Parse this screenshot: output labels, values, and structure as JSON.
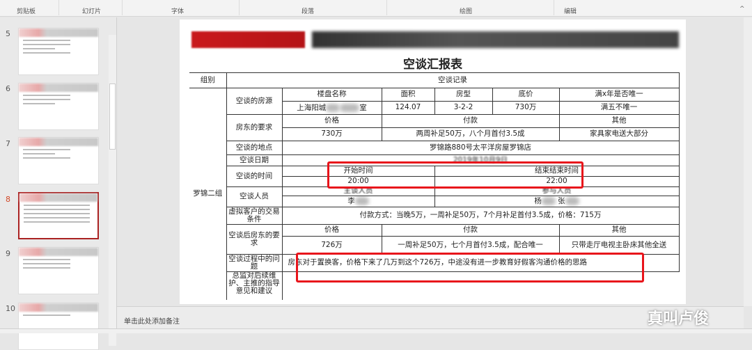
{
  "ribbon": {
    "groups": [
      "剪贴板",
      "幻灯片",
      "字体",
      "段落",
      "绘图",
      "编辑"
    ]
  },
  "thumbnails": [
    {
      "num": "5"
    },
    {
      "num": "6"
    },
    {
      "num": "7"
    },
    {
      "num": "8",
      "selected": true
    },
    {
      "num": "9"
    },
    {
      "num": "10"
    }
  ],
  "slide": {
    "title": "空谈汇报表",
    "table": {
      "group_header": "组别",
      "record_header": "空谈记录",
      "group": "罗锦二组",
      "listing_label": "空谈的房源",
      "listing_cols": [
        "楼盘名称",
        "面积",
        "房型",
        "底价",
        "满x年是否唯一"
      ],
      "listing_name_start": "上海阳城",
      "listing_name_end": "室",
      "listing_vals": [
        "124.07",
        "3-2-2",
        "730万",
        "满五不唯一"
      ],
      "owner_label": "房东的要求",
      "owner_cols": [
        "价格",
        "付款",
        "其他"
      ],
      "owner_vals": [
        "730万",
        "两周补足50万，八个月首付3.5成",
        "家具家电送大部分"
      ],
      "place_label": "空谈的地点",
      "place": "罗锦路880号太平洋房屋罗锦店",
      "date_label": "空谈日期",
      "date": "2019年10月9日",
      "time_label": "空谈的时间",
      "time_cols": [
        "开始时间",
        "结束结束时间"
      ],
      "time_vals": [
        "20:00",
        "22:00"
      ],
      "people_label": "空谈人员",
      "people_cols": [
        "主谈人员",
        "参与人员"
      ],
      "people_main": "李",
      "people_others": [
        "杨",
        "张"
      ],
      "virtual_label": "虚拟客户的交易条件",
      "virtual": "付款方式：当晚5万，一周补足50万，7个月补足首付3.5成，价格：715万",
      "after_label": "空谈后房东的要求",
      "after_cols": [
        "价格",
        "付款",
        "其他"
      ],
      "after_vals": [
        "726万",
        "一周补足50万，七个月首付3.5成，配合唯一",
        "只带走厅电视主卧床其他全送"
      ],
      "problem_label": "空谈过程中的问题",
      "problem": "房东对于置换客，价格下来了几万到这个726万，中途没有进一步教育好假客沟通价格的思路",
      "director_label": "总监对后续维护、主推的指导意见和建议"
    }
  },
  "notes": {
    "placeholder": "单击此处添加备注"
  },
  "watermark": "真叫卢俊",
  "colors": {
    "highlight": "#e8141b",
    "ribbon": "#f3f3f3"
  }
}
